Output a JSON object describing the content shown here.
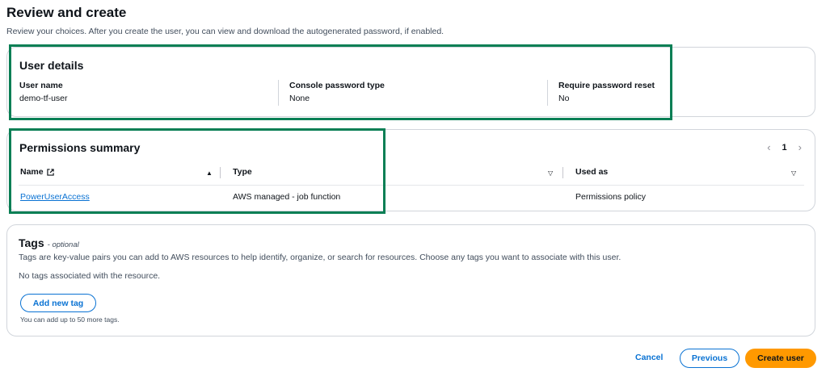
{
  "page": {
    "title": "Review and create",
    "description": "Review your choices. After you create the user, you can view and download the autogenerated password, if enabled."
  },
  "user_details": {
    "heading": "User details",
    "fields": [
      {
        "label": "User name",
        "value": "demo-tf-user"
      },
      {
        "label": "Console password type",
        "value": "None"
      },
      {
        "label": "Require password reset",
        "value": "No"
      }
    ]
  },
  "permissions": {
    "heading": "Permissions summary",
    "page_number": "1",
    "columns": [
      "Name",
      "Type",
      "Used as"
    ],
    "rows": [
      {
        "name": "PowerUserAccess",
        "type": "AWS managed - job function",
        "used_as": "Permissions policy"
      }
    ]
  },
  "tags": {
    "heading": "Tags",
    "optional_label": "- optional",
    "description": "Tags are key-value pairs you can add to AWS resources to help identify, organize, or search for resources. Choose any tags you want to associate with this user.",
    "empty_text": "No tags associated with the resource.",
    "add_button": "Add new tag",
    "hint": "You can add up to 50 more tags."
  },
  "footer": {
    "cancel": "Cancel",
    "previous": "Previous",
    "create": "Create user"
  },
  "colors": {
    "highlight": "#0a7f55",
    "link": "#0972d3",
    "primary_button": "#ff9900"
  }
}
